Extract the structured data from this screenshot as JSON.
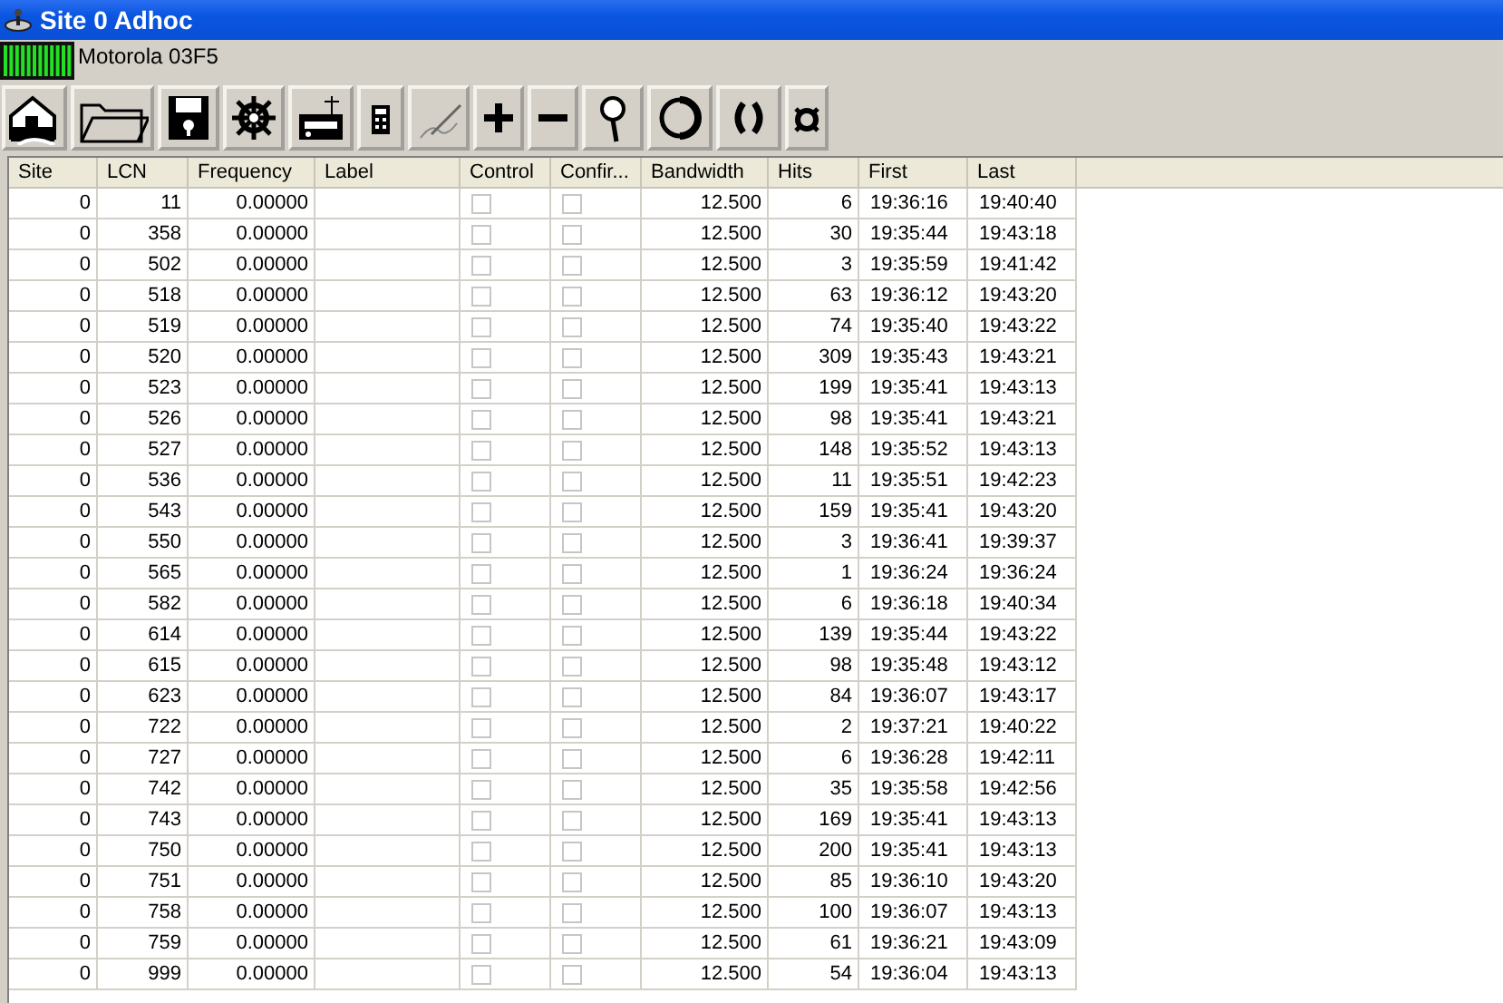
{
  "window": {
    "title": "Site 0 Adhoc"
  },
  "status": {
    "label": "Motorola 03F5"
  },
  "toolbar": [
    {
      "kind": "house"
    },
    {
      "kind": "folder"
    },
    {
      "kind": "floppy"
    },
    {
      "kind": "wheel"
    },
    {
      "kind": "radio"
    },
    {
      "kind": "calculator"
    },
    {
      "kind": "pen"
    },
    {
      "kind": "plus"
    },
    {
      "kind": "minus"
    },
    {
      "kind": "magnifier"
    },
    {
      "kind": "circle"
    },
    {
      "kind": "parens"
    },
    {
      "kind": "currency"
    }
  ],
  "table": {
    "columns": [
      "Site",
      "LCN",
      "Frequency",
      "Label",
      "Control",
      "Confir...",
      "Bandwidth",
      "Hits",
      "First",
      "Last"
    ],
    "rows": [
      {
        "site": "0",
        "lcn": "11",
        "frequency": "0.00000",
        "control": false,
        "confirmed": false,
        "bandwidth": "12.500",
        "hits": "6",
        "first": "19:36:16",
        "last": "19:40:40"
      },
      {
        "site": "0",
        "lcn": "358",
        "frequency": "0.00000",
        "control": false,
        "confirmed": false,
        "bandwidth": "12.500",
        "hits": "30",
        "first": "19:35:44",
        "last": "19:43:18"
      },
      {
        "site": "0",
        "lcn": "502",
        "frequency": "0.00000",
        "control": false,
        "confirmed": false,
        "bandwidth": "12.500",
        "hits": "3",
        "first": "19:35:59",
        "last": "19:41:42"
      },
      {
        "site": "0",
        "lcn": "518",
        "frequency": "0.00000",
        "control": false,
        "confirmed": false,
        "bandwidth": "12.500",
        "hits": "63",
        "first": "19:36:12",
        "last": "19:43:20"
      },
      {
        "site": "0",
        "lcn": "519",
        "frequency": "0.00000",
        "control": false,
        "confirmed": false,
        "bandwidth": "12.500",
        "hits": "74",
        "first": "19:35:40",
        "last": "19:43:22"
      },
      {
        "site": "0",
        "lcn": "520",
        "frequency": "0.00000",
        "control": false,
        "confirmed": false,
        "bandwidth": "12.500",
        "hits": "309",
        "first": "19:35:43",
        "last": "19:43:21"
      },
      {
        "site": "0",
        "lcn": "523",
        "frequency": "0.00000",
        "control": false,
        "confirmed": false,
        "bandwidth": "12.500",
        "hits": "199",
        "first": "19:35:41",
        "last": "19:43:13"
      },
      {
        "site": "0",
        "lcn": "526",
        "frequency": "0.00000",
        "control": false,
        "confirmed": false,
        "bandwidth": "12.500",
        "hits": "98",
        "first": "19:35:41",
        "last": "19:43:21"
      },
      {
        "site": "0",
        "lcn": "527",
        "frequency": "0.00000",
        "control": false,
        "confirmed": false,
        "bandwidth": "12.500",
        "hits": "148",
        "first": "19:35:52",
        "last": "19:43:13"
      },
      {
        "site": "0",
        "lcn": "536",
        "frequency": "0.00000",
        "control": false,
        "confirmed": false,
        "bandwidth": "12.500",
        "hits": "11",
        "first": "19:35:51",
        "last": "19:42:23"
      },
      {
        "site": "0",
        "lcn": "543",
        "frequency": "0.00000",
        "control": false,
        "confirmed": false,
        "bandwidth": "12.500",
        "hits": "159",
        "first": "19:35:41",
        "last": "19:43:20"
      },
      {
        "site": "0",
        "lcn": "550",
        "frequency": "0.00000",
        "control": false,
        "confirmed": false,
        "bandwidth": "12.500",
        "hits": "3",
        "first": "19:36:41",
        "last": "19:39:37"
      },
      {
        "site": "0",
        "lcn": "565",
        "frequency": "0.00000",
        "control": false,
        "confirmed": false,
        "bandwidth": "12.500",
        "hits": "1",
        "first": "19:36:24",
        "last": "19:36:24"
      },
      {
        "site": "0",
        "lcn": "582",
        "frequency": "0.00000",
        "control": false,
        "confirmed": false,
        "bandwidth": "12.500",
        "hits": "6",
        "first": "19:36:18",
        "last": "19:40:34"
      },
      {
        "site": "0",
        "lcn": "614",
        "frequency": "0.00000",
        "control": false,
        "confirmed": false,
        "bandwidth": "12.500",
        "hits": "139",
        "first": "19:35:44",
        "last": "19:43:22"
      },
      {
        "site": "0",
        "lcn": "615",
        "frequency": "0.00000",
        "control": false,
        "confirmed": false,
        "bandwidth": "12.500",
        "hits": "98",
        "first": "19:35:48",
        "last": "19:43:12"
      },
      {
        "site": "0",
        "lcn": "623",
        "frequency": "0.00000",
        "control": false,
        "confirmed": false,
        "bandwidth": "12.500",
        "hits": "84",
        "first": "19:36:07",
        "last": "19:43:17"
      },
      {
        "site": "0",
        "lcn": "722",
        "frequency": "0.00000",
        "control": false,
        "confirmed": false,
        "bandwidth": "12.500",
        "hits": "2",
        "first": "19:37:21",
        "last": "19:40:22"
      },
      {
        "site": "0",
        "lcn": "727",
        "frequency": "0.00000",
        "control": false,
        "confirmed": false,
        "bandwidth": "12.500",
        "hits": "6",
        "first": "19:36:28",
        "last": "19:42:11"
      },
      {
        "site": "0",
        "lcn": "742",
        "frequency": "0.00000",
        "control": false,
        "confirmed": false,
        "bandwidth": "12.500",
        "hits": "35",
        "first": "19:35:58",
        "last": "19:42:56"
      },
      {
        "site": "0",
        "lcn": "743",
        "frequency": "0.00000",
        "control": false,
        "confirmed": false,
        "bandwidth": "12.500",
        "hits": "169",
        "first": "19:35:41",
        "last": "19:43:13"
      },
      {
        "site": "0",
        "lcn": "750",
        "frequency": "0.00000",
        "control": false,
        "confirmed": false,
        "bandwidth": "12.500",
        "hits": "200",
        "first": "19:35:41",
        "last": "19:43:13"
      },
      {
        "site": "0",
        "lcn": "751",
        "frequency": "0.00000",
        "control": false,
        "confirmed": false,
        "bandwidth": "12.500",
        "hits": "85",
        "first": "19:36:10",
        "last": "19:43:20"
      },
      {
        "site": "0",
        "lcn": "758",
        "frequency": "0.00000",
        "control": false,
        "confirmed": false,
        "bandwidth": "12.500",
        "hits": "100",
        "first": "19:36:07",
        "last": "19:43:13"
      },
      {
        "site": "0",
        "lcn": "759",
        "frequency": "0.00000",
        "control": false,
        "confirmed": false,
        "bandwidth": "12.500",
        "hits": "61",
        "first": "19:36:21",
        "last": "19:43:09"
      },
      {
        "site": "0",
        "lcn": "999",
        "frequency": "0.00000",
        "control": false,
        "confirmed": false,
        "bandwidth": "12.500",
        "hits": "54",
        "first": "19:36:04",
        "last": "19:43:13"
      }
    ]
  }
}
